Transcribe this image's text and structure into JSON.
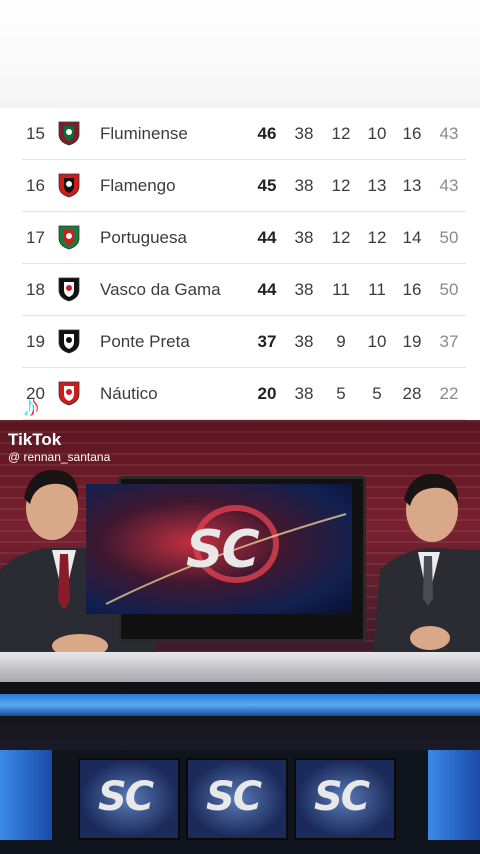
{
  "standings": [
    {
      "pos": "15",
      "team": "Fluminense",
      "pts": "46",
      "j": "38",
      "v": "12",
      "e": "10",
      "d": "16",
      "gp": "43",
      "colors": [
        "#7a1f2b",
        "#0b6b3a",
        "#ffffff"
      ]
    },
    {
      "pos": "16",
      "team": "Flamengo",
      "pts": "45",
      "j": "38",
      "v": "12",
      "e": "13",
      "d": "13",
      "gp": "43",
      "colors": [
        "#d11a1a",
        "#111111",
        "#ffffff"
      ]
    },
    {
      "pos": "17",
      "team": "Portuguesa",
      "pts": "44",
      "j": "38",
      "v": "12",
      "e": "12",
      "d": "14",
      "gp": "50",
      "colors": [
        "#1a7a3a",
        "#d11a1a",
        "#ffffff"
      ]
    },
    {
      "pos": "18",
      "team": "Vasco da Gama",
      "pts": "44",
      "j": "38",
      "v": "11",
      "e": "11",
      "d": "16",
      "gp": "50",
      "colors": [
        "#111111",
        "#ffffff",
        "#d11a1a"
      ]
    },
    {
      "pos": "19",
      "team": "Ponte Preta",
      "pts": "37",
      "j": "38",
      "v": "9",
      "e": "10",
      "d": "19",
      "gp": "37",
      "colors": [
        "#111111",
        "#ffffff",
        "#111111"
      ]
    },
    {
      "pos": "20",
      "team": "Náutico",
      "pts": "20",
      "j": "38",
      "v": "5",
      "e": "5",
      "d": "28",
      "gp": "22",
      "colors": [
        "#d11a1a",
        "#ffffff",
        "#d11a1a"
      ]
    }
  ],
  "watermark": {
    "app": "TikTok",
    "user": "@ rennan_santana",
    "icon": "tiktok-note-icon"
  },
  "video": {
    "logo_text": "SC",
    "colors": {
      "accent": "#c23040",
      "blue": "#2a7ad8"
    }
  }
}
